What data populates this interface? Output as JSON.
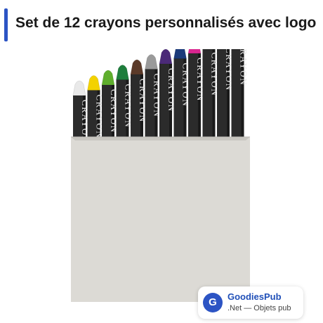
{
  "header": {
    "title": "Set de 12 crayons personnalisés avec logo",
    "accent_color": "#2c54c4"
  },
  "product": {
    "crayon_label": "CRAYON",
    "crayon_colors": [
      "#e9e9e9",
      "#f3d200",
      "#5fae2d",
      "#1e7d3c",
      "#5b3a29",
      "#9a9a9a",
      "#4b2a78",
      "#1b3a7a",
      "#d9268f",
      "#151515",
      "#e25a1c",
      "#d8262f"
    ],
    "box_color": "#dcdad5"
  },
  "brand": {
    "logo_letter": "G",
    "logo_color": "#2c54c4",
    "name": "GoodiesPub",
    "tagline": ".Net — Objets pub"
  }
}
